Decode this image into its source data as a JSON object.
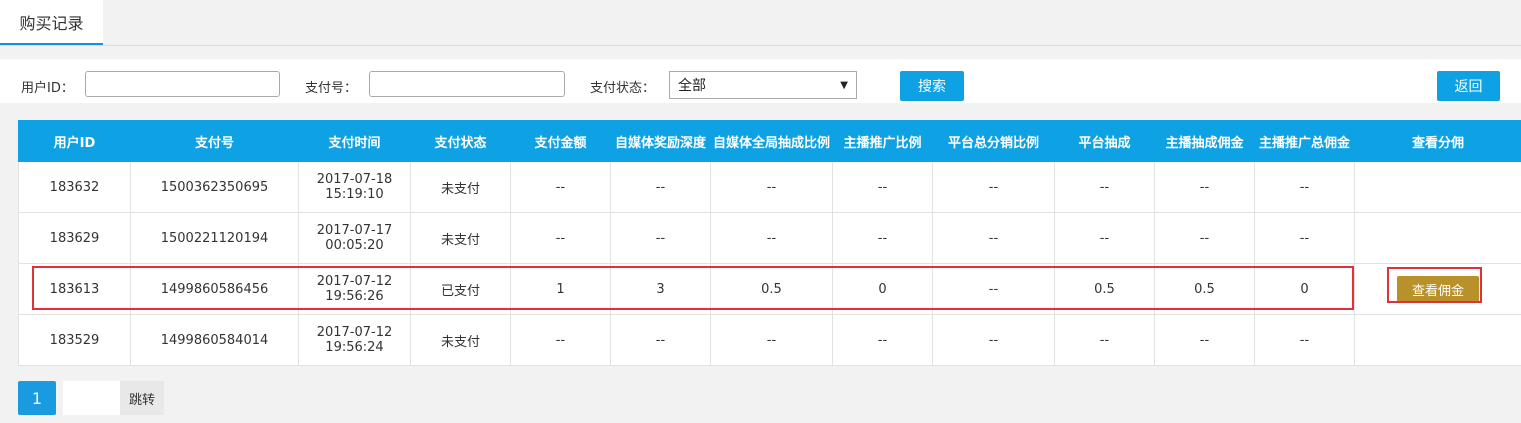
{
  "tab": {
    "label": "购买记录"
  },
  "filters": {
    "user_id_label": "用户ID：",
    "user_id_value": "",
    "pay_no_label": "支付号：",
    "pay_no_value": "",
    "status_label": "支付状态：",
    "status_selected": "全部",
    "search_label": "搜索",
    "back_label": "返回"
  },
  "table": {
    "headers": [
      "用户ID",
      "支付号",
      "支付时间",
      "支付状态",
      "支付金额",
      "自媒体奖励深度",
      "自媒体全局抽成比例",
      "主播推广比例",
      "平台总分销比例",
      "平台抽成",
      "主播抽成佣金",
      "主播推广总佣金",
      "查看分佣"
    ],
    "rows": [
      {
        "user_id": "183632",
        "pay_no": "1500362350695",
        "date": "2017-07-18",
        "time": "15:19:10",
        "status": "未支付",
        "amount": "--",
        "depth": "--",
        "global_ratio": "--",
        "promo_ratio": "--",
        "dist_ratio": "--",
        "platform_cut": "--",
        "anchor_commission": "--",
        "promo_total": "--",
        "action": ""
      },
      {
        "user_id": "183629",
        "pay_no": "1500221120194",
        "date": "2017-07-17",
        "time": "00:05:20",
        "status": "未支付",
        "amount": "--",
        "depth": "--",
        "global_ratio": "--",
        "promo_ratio": "--",
        "dist_ratio": "--",
        "platform_cut": "--",
        "anchor_commission": "--",
        "promo_total": "--",
        "action": ""
      },
      {
        "user_id": "183613",
        "pay_no": "1499860586456",
        "date": "2017-07-12",
        "time": "19:56:26",
        "status": "已支付",
        "amount": "1",
        "depth": "3",
        "global_ratio": "0.5",
        "promo_ratio": "0",
        "dist_ratio": "--",
        "platform_cut": "0.5",
        "anchor_commission": "0.5",
        "promo_total": "0",
        "action": "查看佣金"
      },
      {
        "user_id": "183529",
        "pay_no": "1499860584014",
        "date": "2017-07-12",
        "time": "19:56:24",
        "status": "未支付",
        "amount": "--",
        "depth": "--",
        "global_ratio": "--",
        "promo_ratio": "--",
        "dist_ratio": "--",
        "platform_cut": "--",
        "anchor_commission": "--",
        "promo_total": "--",
        "action": ""
      }
    ]
  },
  "pager": {
    "current": "1",
    "jump_label": "跳转",
    "jump_value": ""
  },
  "colors": {
    "primary": "#0ea1e3",
    "commission_button": "#b8912a",
    "highlight": "#e0303a"
  }
}
